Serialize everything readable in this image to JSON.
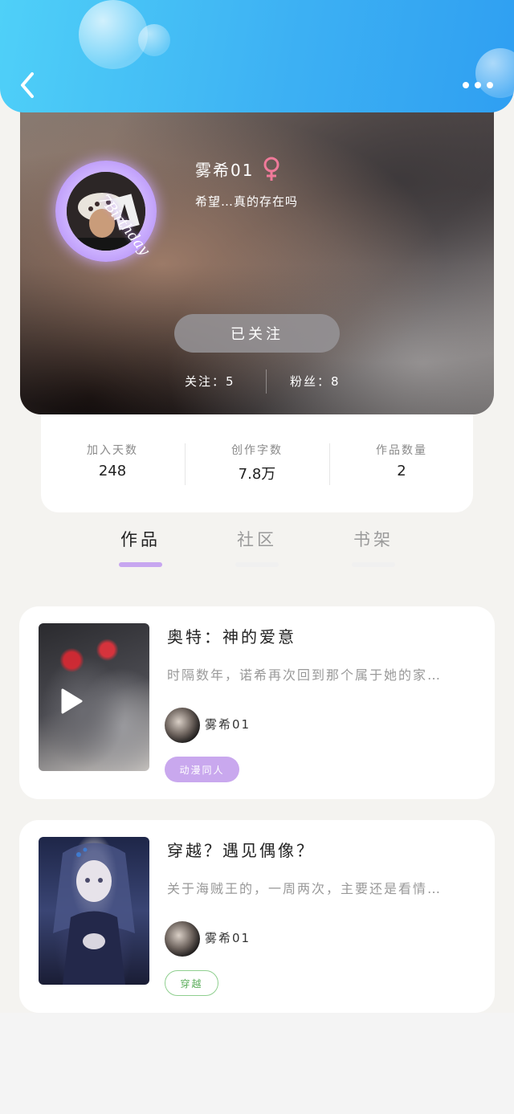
{
  "header": {
    "back_label": "",
    "more_label": ""
  },
  "profile": {
    "avatar_decoration_text": "7Birthday",
    "name": "雾希01",
    "gender": "female",
    "bio": "希望…真的存在吗",
    "follow_button": "已关注",
    "following_count_text": "关注：5",
    "fans_count_text": "粉丝：8"
  },
  "stats": [
    {
      "label": "加入天数",
      "value": "248"
    },
    {
      "label": "创作字数",
      "value": "7.8万"
    },
    {
      "label": "作品数量",
      "value": "2"
    }
  ],
  "tabs": [
    {
      "label": "作品",
      "active": true
    },
    {
      "label": "社区",
      "active": false
    },
    {
      "label": "书架",
      "active": false
    }
  ],
  "works": [
    {
      "title": "奥特：神的爱意",
      "description": "时隔数年，诺希再次回到那个属于她的家…",
      "author": "雾希01",
      "tag": "动漫同人",
      "tag_style": "filled",
      "has_video": true
    },
    {
      "title": "穿越？遇见偶像？",
      "description": "关于海贼王的，一周两次，主要还是看情…",
      "author": "雾希01",
      "tag": "穿越",
      "tag_style": "outline",
      "has_video": false
    }
  ],
  "colors": {
    "header_gradient_start": "#4fd0f8",
    "header_gradient_end": "#2f9ff2",
    "tab_active_underline": "#c7a6f0",
    "tag_filled_bg": "#c9a8ee",
    "tag_outline": "#8fcf8f",
    "gender_icon": "#f07a9a"
  },
  "icons": [
    "back-arrow-icon",
    "more-dots-icon",
    "female-gender-icon",
    "play-icon"
  ]
}
